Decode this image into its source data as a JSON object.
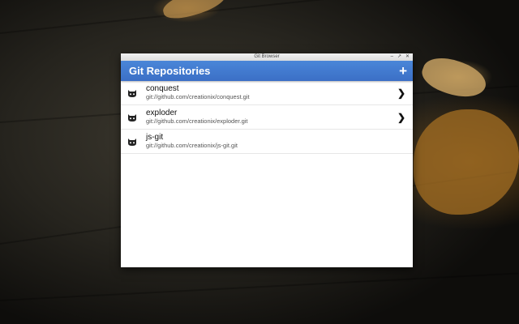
{
  "window": {
    "title": "Git Browser",
    "controls": [
      "minimize-icon",
      "maximize-icon",
      "close-icon"
    ]
  },
  "appbar": {
    "title": "Git Repositories",
    "add_icon": "plus-icon"
  },
  "repos": [
    {
      "name": "conquest",
      "url": "git://github.com/creationix/conquest.git",
      "has_chevron": true
    },
    {
      "name": "exploder",
      "url": "git://github.com/creationix/exploder.git",
      "has_chevron": true
    },
    {
      "name": "js-git",
      "url": "git://github.com/creationix/js-git.git",
      "has_chevron": false
    }
  ],
  "colors": {
    "appbar": "#3b6fc6",
    "background": "#2a2822"
  }
}
